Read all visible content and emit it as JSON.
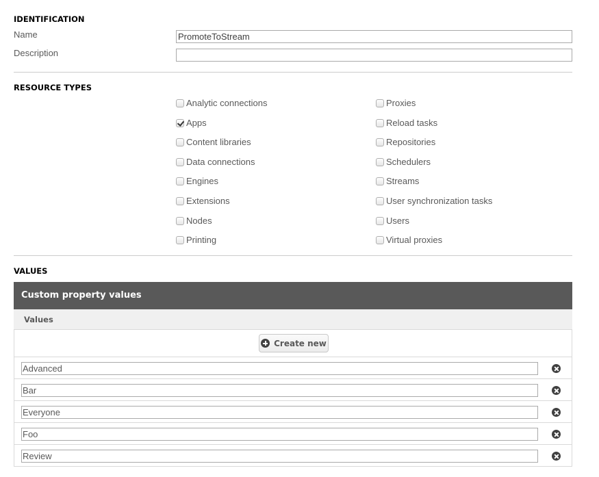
{
  "identification": {
    "title": "IDENTIFICATION",
    "name_label": "Name",
    "name_value": "PromoteToStream",
    "description_label": "Description",
    "description_value": ""
  },
  "resource_types": {
    "title": "RESOURCE TYPES",
    "left_column": [
      {
        "label": "Analytic connections",
        "checked": false
      },
      {
        "label": "Apps",
        "checked": true
      },
      {
        "label": "Content libraries",
        "checked": false
      },
      {
        "label": "Data connections",
        "checked": false
      },
      {
        "label": "Engines",
        "checked": false
      },
      {
        "label": "Extensions",
        "checked": false
      },
      {
        "label": "Nodes",
        "checked": false
      },
      {
        "label": "Printing",
        "checked": false
      }
    ],
    "right_column": [
      {
        "label": "Proxies",
        "checked": false
      },
      {
        "label": "Reload tasks",
        "checked": false
      },
      {
        "label": "Repositories",
        "checked": false
      },
      {
        "label": "Schedulers",
        "checked": false
      },
      {
        "label": "Streams",
        "checked": false
      },
      {
        "label": "User synchronization tasks",
        "checked": false
      },
      {
        "label": "Users",
        "checked": false
      },
      {
        "label": "Virtual proxies",
        "checked": false
      }
    ]
  },
  "values": {
    "title": "VALUES",
    "panel_title": "Custom property values",
    "column_header": "Values",
    "create_button_label": "Create new",
    "items": [
      "Advanced",
      "Bar",
      "Everyone",
      "Foo",
      "Review"
    ]
  }
}
